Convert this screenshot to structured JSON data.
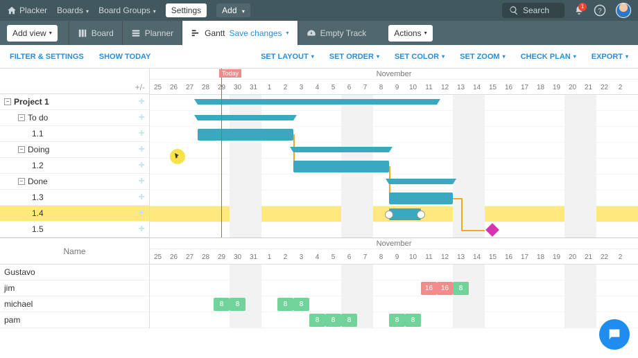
{
  "top": {
    "app": "Placker",
    "nav1": "Boards",
    "nav2": "Board Groups",
    "settings": "Settings",
    "add": "Add",
    "search": "Search",
    "notif_count": "1"
  },
  "views": {
    "addview": "Add view",
    "board": "Board",
    "planner": "Planner",
    "gantt": "Gantt",
    "save": "Save changes",
    "empty": "Empty Track",
    "actions": "Actions"
  },
  "ctrl": {
    "filter": "FILTER & SETTINGS",
    "today": "SHOW TODAY",
    "layout": "SET LAYOUT",
    "order": "SET ORDER",
    "color": "SET COLOR",
    "zoom": "SET ZOOM",
    "check": "CHECK PLAN",
    "export": "EXPORT"
  },
  "tree": {
    "expand_hint": "+/-",
    "rows": [
      "Project 1",
      "To do",
      "1.1",
      "Doing",
      "1.2",
      "Done",
      "1.3",
      "1.4",
      "1.5"
    ]
  },
  "timeline": {
    "month": "November",
    "days": [
      "25",
      "26",
      "27",
      "28",
      "29",
      "30",
      "31",
      "1",
      "2",
      "3",
      "4",
      "5",
      "6",
      "7",
      "8",
      "9",
      "10",
      "11",
      "12",
      "13",
      "14",
      "15",
      "16",
      "17",
      "18",
      "19",
      "20",
      "21",
      "22",
      "2"
    ],
    "today": "Today",
    "today_col": 4,
    "weekend_cols": [
      5,
      6,
      12,
      13,
      19,
      20,
      26,
      27
    ]
  },
  "bars": {
    "summary": [
      {
        "row": 0,
        "start": 3,
        "end": 18
      },
      {
        "row": 1,
        "start": 3,
        "end": 9
      },
      {
        "row": 3,
        "start": 9,
        "end": 15
      },
      {
        "row": 5,
        "start": 15,
        "end": 19
      }
    ],
    "tasks": [
      {
        "row": 2,
        "start": 3,
        "end": 9
      },
      {
        "row": 4,
        "start": 9,
        "end": 15
      },
      {
        "row": 6,
        "start": 15,
        "end": 19
      },
      {
        "row": 7,
        "start": 15,
        "end": 17
      }
    ],
    "milestone": {
      "row": 8,
      "col": 21
    },
    "highlight_row": 7
  },
  "resources": {
    "header": "Name",
    "names": [
      "Gustavo",
      "jim",
      "michael",
      "pam"
    ],
    "month": "November",
    "cells": [
      {
        "row": 1,
        "col": 17,
        "v": "16",
        "c": "r"
      },
      {
        "row": 1,
        "col": 18,
        "v": "16",
        "c": "r"
      },
      {
        "row": 1,
        "col": 19,
        "v": "8",
        "c": "g"
      },
      {
        "row": 2,
        "col": 4,
        "v": "8",
        "c": "g"
      },
      {
        "row": 2,
        "col": 5,
        "v": "8",
        "c": "g"
      },
      {
        "row": 2,
        "col": 8,
        "v": "8",
        "c": "g"
      },
      {
        "row": 2,
        "col": 9,
        "v": "8",
        "c": "g"
      },
      {
        "row": 3,
        "col": 10,
        "v": "8",
        "c": "g"
      },
      {
        "row": 3,
        "col": 11,
        "v": "8",
        "c": "g"
      },
      {
        "row": 3,
        "col": 12,
        "v": "8",
        "c": "g"
      },
      {
        "row": 3,
        "col": 15,
        "v": "8",
        "c": "g"
      },
      {
        "row": 3,
        "col": 16,
        "v": "8",
        "c": "g"
      }
    ]
  },
  "chart_data": {
    "type": "bar",
    "title": "Gantt timeline",
    "tasks": [
      {
        "name": "Project 1",
        "start": "Oct 28",
        "end": "Nov 12",
        "type": "summary"
      },
      {
        "name": "To do",
        "start": "Oct 28",
        "end": "Nov 3",
        "type": "summary"
      },
      {
        "name": "1.1",
        "start": "Oct 28",
        "end": "Nov 3",
        "type": "task"
      },
      {
        "name": "Doing",
        "start": "Nov 3",
        "end": "Nov 9",
        "type": "summary"
      },
      {
        "name": "1.2",
        "start": "Nov 3",
        "end": "Nov 9",
        "type": "task"
      },
      {
        "name": "Done",
        "start": "Nov 9",
        "end": "Nov 13",
        "type": "summary"
      },
      {
        "name": "1.3",
        "start": "Nov 9",
        "end": "Nov 13",
        "type": "task"
      },
      {
        "name": "1.4",
        "start": "Nov 9",
        "end": "Nov 11",
        "type": "task"
      },
      {
        "name": "1.5",
        "start": "Nov 15",
        "end": "Nov 15",
        "type": "milestone"
      }
    ],
    "resources_hours": {
      "jim": {
        "Nov 11": 16,
        "Nov 12": 16,
        "Nov 13": 8
      },
      "michael": {
        "Oct 29": 8,
        "Oct 30": 8,
        "Nov 2": 8,
        "Nov 3": 8
      },
      "pam": {
        "Nov 4": 8,
        "Nov 5": 8,
        "Nov 6": 8,
        "Nov 9": 8,
        "Nov 10": 8
      }
    }
  }
}
